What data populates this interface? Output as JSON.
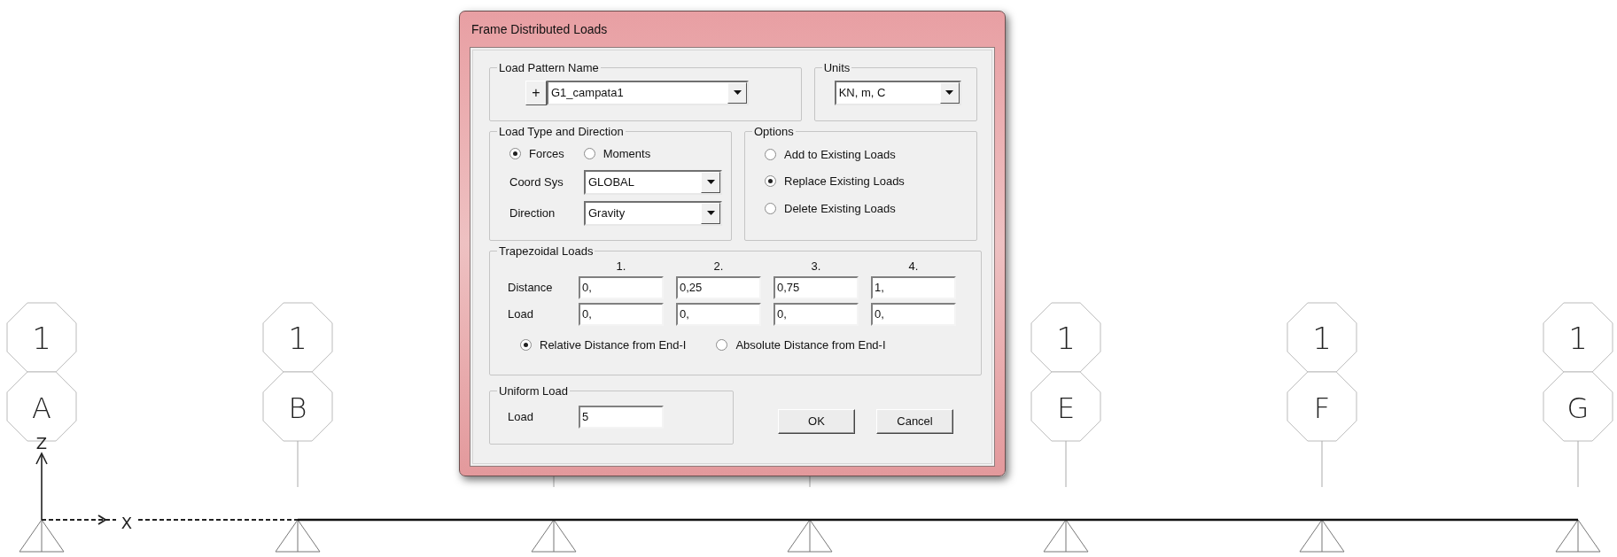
{
  "canvas": {
    "axes": {
      "z": "Z",
      "x": "X"
    },
    "grid_lines": [
      {
        "number": "1",
        "label": "A"
      },
      {
        "number": "1",
        "label": "B"
      },
      {
        "number": "1",
        "label": "E"
      },
      {
        "number": "1",
        "label": "F"
      },
      {
        "number": "1",
        "label": "G"
      }
    ]
  },
  "window": {
    "title": "Frame Distributed Loads"
  },
  "load_pattern": {
    "legend": "Load Pattern Name",
    "add_button": "+",
    "value": "G1_campata1"
  },
  "units": {
    "legend": "Units",
    "value": "KN, m, C"
  },
  "load_type": {
    "legend": "Load Type and Direction",
    "types": [
      {
        "label": "Forces",
        "selected": true
      },
      {
        "label": "Moments",
        "selected": false
      }
    ],
    "coord_sys": {
      "label": "Coord Sys",
      "value": "GLOBAL"
    },
    "direction": {
      "label": "Direction",
      "value": "Gravity"
    }
  },
  "options": {
    "legend": "Options",
    "items": [
      {
        "label": "Add to Existing Loads",
        "selected": false
      },
      {
        "label": "Replace Existing Loads",
        "selected": true
      },
      {
        "label": "Delete Existing Loads",
        "selected": false
      }
    ]
  },
  "trapezoidal": {
    "legend": "Trapezoidal Loads",
    "columns": [
      "1.",
      "2.",
      "3.",
      "4."
    ],
    "rows": [
      {
        "label": "Distance",
        "values": [
          "0,",
          "0,25",
          "0,75",
          "1,"
        ]
      },
      {
        "label": "Load",
        "values": [
          "0,",
          "0,",
          "0,",
          "0,"
        ]
      }
    ],
    "distance_modes": [
      {
        "label": "Relative Distance from End-I",
        "selected": true
      },
      {
        "label": "Absolute Distance from End-I",
        "selected": false
      }
    ]
  },
  "uniform": {
    "legend": "Uniform Load",
    "label": "Load",
    "value": "5"
  },
  "buttons": [
    "OK",
    "Cancel"
  ]
}
